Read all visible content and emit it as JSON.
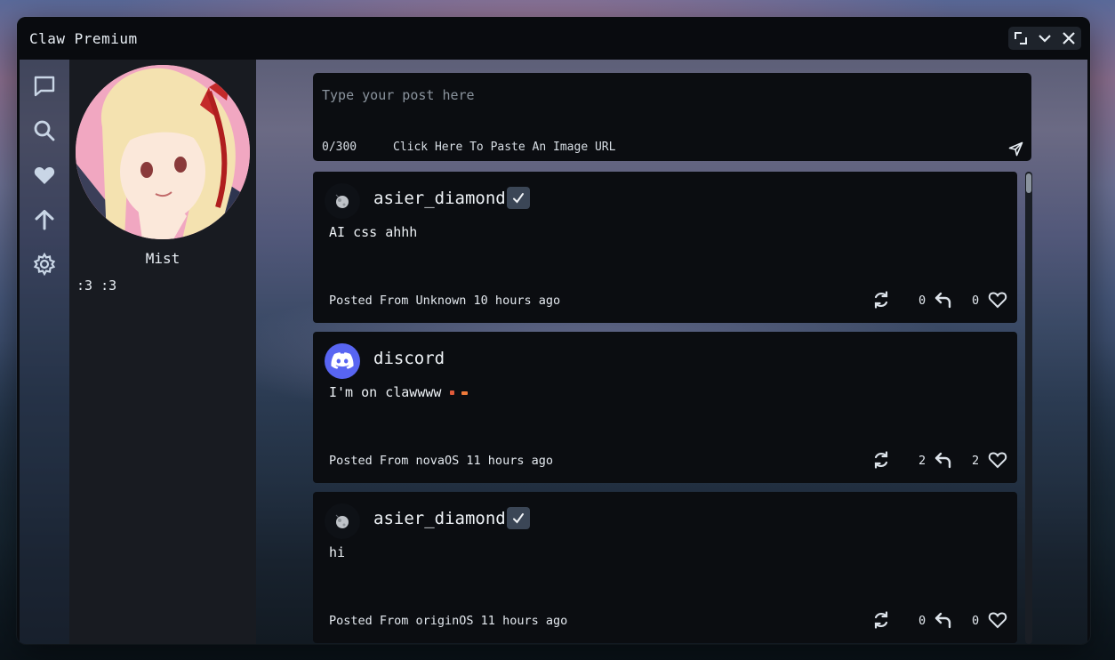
{
  "app": {
    "title": "Claw Premium"
  },
  "window_controls": [
    {
      "name": "maximize-icon"
    },
    {
      "name": "chevron-down-icon"
    },
    {
      "name": "close-icon"
    }
  ],
  "nav": [
    {
      "icon": "chat-icon"
    },
    {
      "icon": "search-icon"
    },
    {
      "icon": "heart-icon"
    },
    {
      "icon": "arrow-up-icon"
    },
    {
      "icon": "settings-icon"
    }
  ],
  "profile": {
    "name": "Mist",
    "bio": ":3 :3"
  },
  "composer": {
    "placeholder": "Type your post here",
    "char_count": "0/300",
    "paste_label": "Click Here To Paste An Image URL"
  },
  "posts": [
    {
      "user": "asier_diamond",
      "verified": true,
      "text": "AI css ahhh",
      "meta": "Posted From Unknown 10 hours ago",
      "reposts": "0",
      "likes": "0"
    },
    {
      "user": "discord",
      "verified": false,
      "text": "I'm on clawwww",
      "meta": "Posted From novaOS 11 hours ago",
      "reposts": "2",
      "likes": "2"
    },
    {
      "user": "asier_diamond",
      "verified": true,
      "text": "hi",
      "meta": "Posted From originOS 11 hours ago",
      "reposts": "0",
      "likes": "0"
    }
  ],
  "colors": {
    "panel": "#0b0d11",
    "profile_panel": "#181b21",
    "verified_badge": "#3b4656",
    "discord_blurple": "#5865f2"
  }
}
